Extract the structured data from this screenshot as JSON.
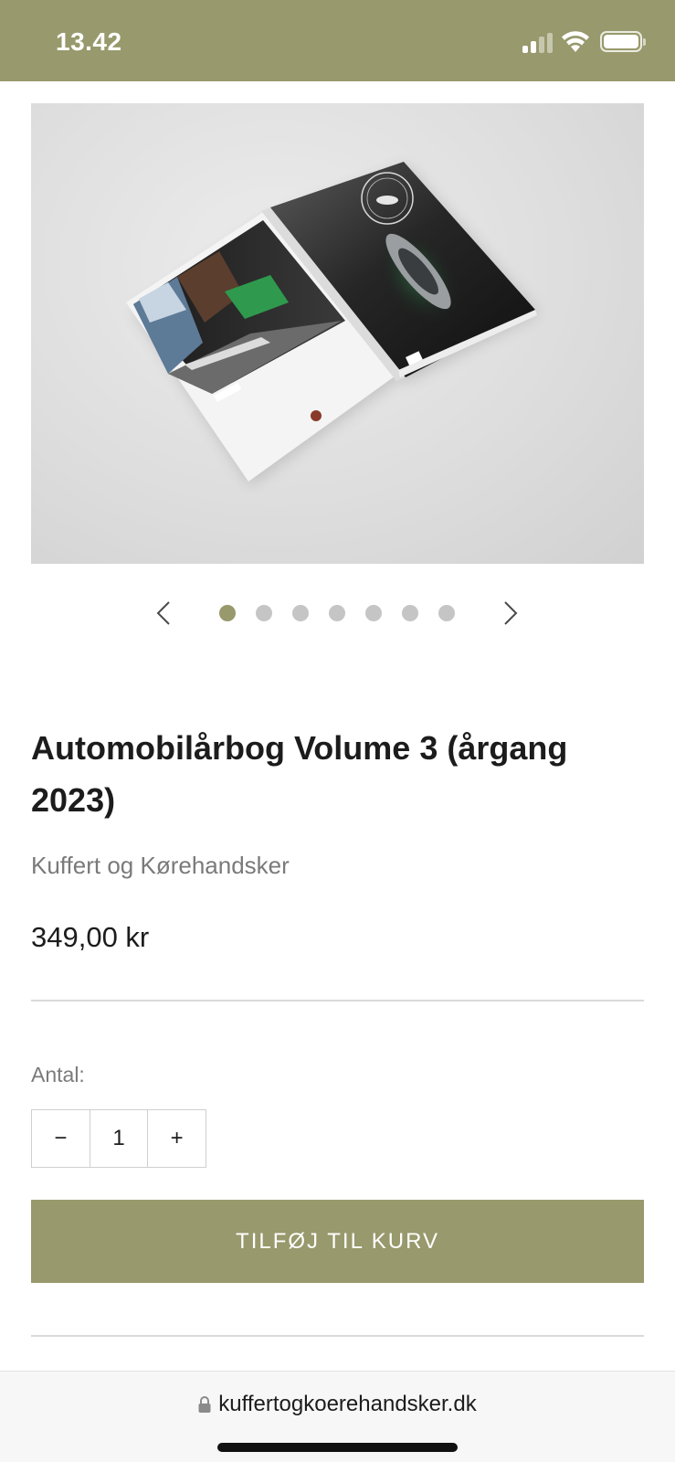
{
  "status_bar": {
    "time": "13.42",
    "icons": [
      "signal-icon",
      "wifi-icon",
      "battery-icon"
    ]
  },
  "product_image": {
    "description_alt": "Automobilårbog Volume 3 magazine"
  },
  "carousel": {
    "total_slides": 7,
    "active_index": 0,
    "prev_icon": "chevron-left-icon",
    "next_icon": "chevron-right-icon"
  },
  "product": {
    "title": "Automobilårbog Volume 3 (årgang 2023)",
    "vendor": "Kuffert og Kørehandsker",
    "price": "349,00 kr"
  },
  "quantity": {
    "label": "Antal:",
    "minus": "−",
    "value": "1",
    "plus": "+"
  },
  "cart": {
    "add_label": "TILFØJ TIL KURV"
  },
  "browser": {
    "url": "kuffertogkoerehandsker.dk"
  },
  "colors": {
    "accent": "#98996c",
    "dot_inactive": "#c5c5c5",
    "divider": "#d9d9d9"
  }
}
